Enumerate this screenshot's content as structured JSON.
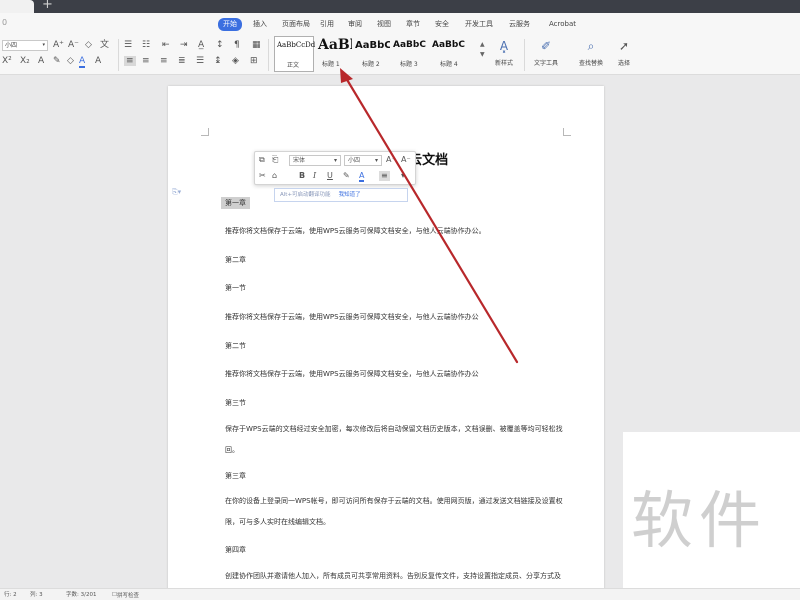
{
  "menu": {
    "left_mark": "0",
    "tabs": [
      {
        "label": "开始",
        "active": true
      },
      {
        "label": "插入"
      },
      {
        "label": "页面布局"
      },
      {
        "label": "引用"
      },
      {
        "label": "审阅"
      },
      {
        "label": "视图"
      },
      {
        "label": "章节"
      },
      {
        "label": "安全"
      },
      {
        "label": "开发工具"
      },
      {
        "label": "云服务"
      },
      {
        "label": "Acrobat"
      }
    ],
    "active_color": "#3b6fe0"
  },
  "ribbon": {
    "font_size_top": "小四",
    "styles": [
      {
        "sample": "AaBbCcDd",
        "name": "正文"
      },
      {
        "sample": "AaBl",
        "name": "标题 1"
      },
      {
        "sample": "AaBbC",
        "name": "标题 2"
      },
      {
        "sample": "AaBbC",
        "name": "标题 3"
      },
      {
        "sample": "AaBbC",
        "name": "标题 4"
      }
    ],
    "new_style_label": "新样式",
    "text_tool_label": "文字工具",
    "find_replace_label": "查找替换",
    "select_label": "选择"
  },
  "document": {
    "title": "欢迎使用WPS云文档",
    "paragraphs": [
      {
        "text": "第一章",
        "heading": true,
        "highlighted": true
      },
      {
        "text": "推荐你将文档保存于云端，使用WPS云服务可保障文档安全，与他人云端协作办公。"
      },
      {
        "text": "第二章",
        "heading": true
      },
      {
        "text": "第一节",
        "heading": true
      },
      {
        "text": "推荐你将文档保存于云端，使用WPS云服务可保障文档安全，与他人云端协作办公"
      },
      {
        "text": "第二节",
        "heading": true
      },
      {
        "text": "推荐你将文档保存于云端，使用WPS云服务可保障文档安全，与他人云端协作办公"
      },
      {
        "text": "第三节",
        "heading": true
      },
      {
        "text": "保存于WPS云端的文档经过安全加密，每次修改后将自动保留文档历史版本，文档误删、被覆盖等均可轻松找回。"
      },
      {
        "text": "第三章",
        "heading": true
      },
      {
        "text": "在你的设备上登录同一WPS帐号，即可访问所有保存于云端的文档。使用网页版，通过发送文档链接及设置权限，可与多人实时在线编辑文档。"
      },
      {
        "text": "第四章",
        "heading": true
      },
      {
        "text": "创建协作团队并邀请他人加入，所有成员可共享常用资料。告别反复传文件，支持设置指定成员、分享方式及编辑权限。"
      }
    ]
  },
  "mini_toolbar": {
    "font_name": "宋体",
    "font_size": "小四",
    "bold": "B",
    "italic": "I",
    "underline": "U",
    "font_color_letter": "A",
    "ai_tip": "Alt+可启动翻译功能",
    "ai_tip_action": "我知道了"
  },
  "annotation": {
    "color": "#b8282b"
  },
  "watermark": {
    "text": "软件"
  },
  "status": {
    "page": "行: 2",
    "section": "列: 3",
    "words": "字数: 3/201",
    "spell": "拼写检查"
  }
}
